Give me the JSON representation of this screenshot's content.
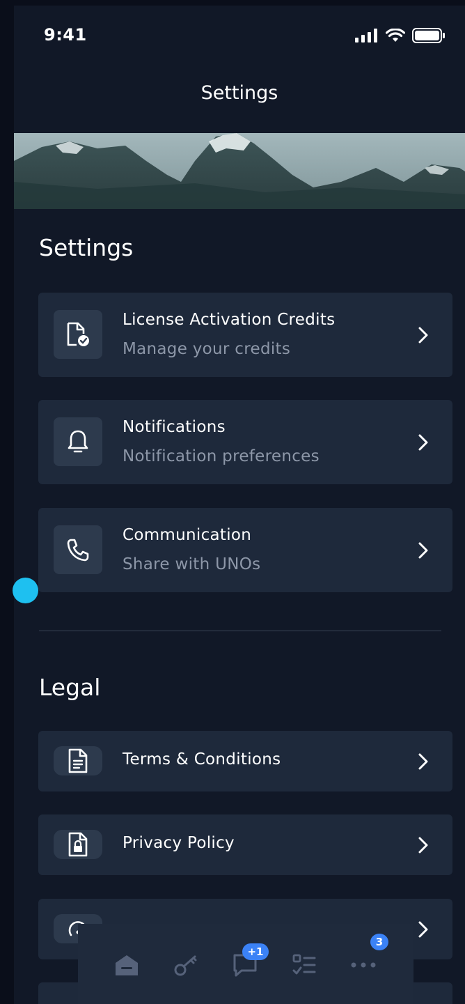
{
  "status_bar": {
    "time": "9:41"
  },
  "nav": {
    "title": "Settings"
  },
  "settings_section": {
    "heading": "Settings",
    "items": [
      {
        "title": "License Activation Credits",
        "subtitle": "Manage your credits",
        "icon": "document-check-icon"
      },
      {
        "title": "Notifications",
        "subtitle": "Notification preferences",
        "icon": "bell-icon"
      },
      {
        "title": "Communication",
        "subtitle": "Share with UNOs",
        "icon": "phone-icon"
      }
    ]
  },
  "legal_section": {
    "heading": "Legal",
    "items": [
      {
        "title": "Terms & Conditions",
        "icon": "document-lines-icon"
      },
      {
        "title": "Privacy Policy",
        "icon": "document-lock-icon"
      }
    ]
  },
  "tab_bar": {
    "tabs": [
      {
        "name": "home",
        "icon": "home-icon"
      },
      {
        "name": "keys",
        "icon": "key-icon"
      },
      {
        "name": "messages",
        "icon": "chat-icon",
        "badge": "+1"
      },
      {
        "name": "tasks",
        "icon": "checklist-icon"
      },
      {
        "name": "more",
        "icon": "more-dots-icon",
        "badge": "3"
      }
    ]
  },
  "colors": {
    "background": "#111827",
    "card": "#1e293b",
    "icon_tile": "#2d3a4d",
    "subtitle": "#8d97a8",
    "badge": "#3b82f6",
    "accent_dot": "#1ec0f0"
  }
}
